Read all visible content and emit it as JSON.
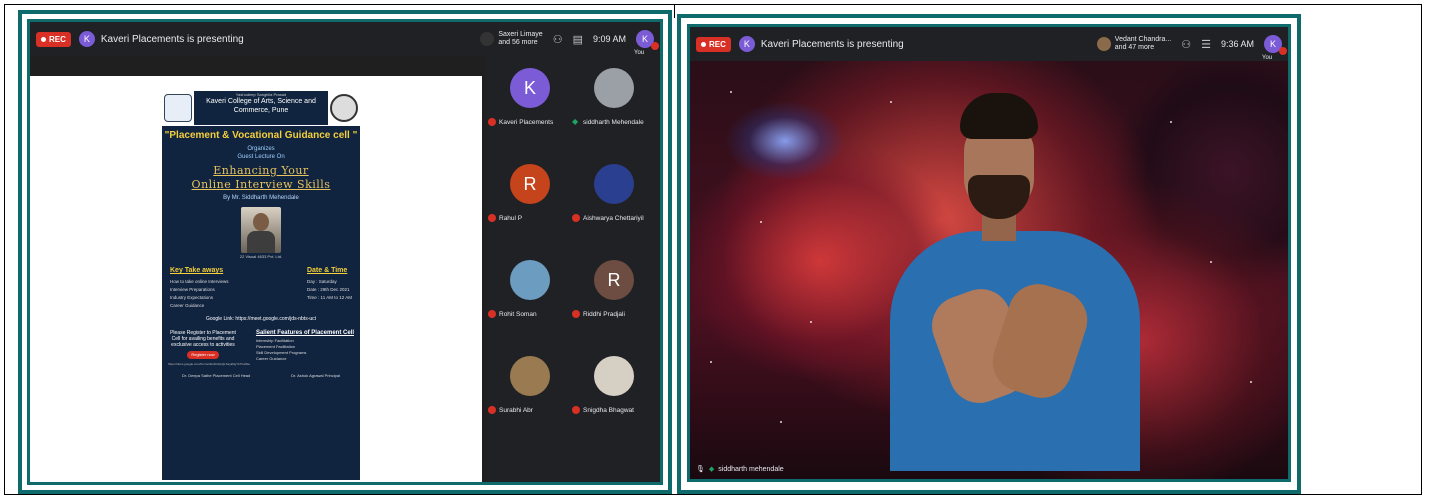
{
  "left_screen": {
    "rec_label": "REC",
    "presenter_initial": "K",
    "presenting_text": "Kaveri Placements is presenting",
    "others_text_line1": "Saxeri Limaye",
    "others_text_line2": "and 56 more",
    "clock": "9:09 AM",
    "you_initial": "K",
    "you_label": "You",
    "participants": [
      {
        "initial": "K",
        "name": "Kaveri Placements",
        "color": "#7b5cd6",
        "mic": "off"
      },
      {
        "initial": "",
        "name": "siddharth Mehendale",
        "color": "#8b8b8b",
        "mic": "on"
      },
      {
        "initial": "R",
        "name": "Rahul P",
        "color": "#c5441c",
        "mic": "off"
      },
      {
        "initial": "",
        "name": "Aishwarya Chettariyil",
        "color": "#2a3f8f",
        "mic": "off"
      },
      {
        "initial": "",
        "name": "Rohit Soman",
        "color": "#6c9cc0",
        "mic": "off"
      },
      {
        "initial": "R",
        "name": "Riddhi Pradjali",
        "color": "#6d4c41",
        "mic": "off"
      },
      {
        "initial": "",
        "name": "Surabhi Abr",
        "color": "#9a7a50",
        "mic": "off"
      },
      {
        "initial": "",
        "name": "Snigdha Bhagwat",
        "color": "#d6cfc4",
        "mic": "off"
      }
    ],
    "poster": {
      "college_tiny": "Yashodeep Sanghila Prasad",
      "college": "Kaveri College of Arts, Science and Commerce, Pune",
      "cell": "\"Placement & Vocational Guidance cell \"",
      "organizes": "Organizes",
      "guest": "Guest Lecture On",
      "title_line1": "Enhancing Your",
      "title_line2": "Online Interview Skills",
      "by": "By Mr. Siddharth Mehendale",
      "photo_caption": "22 Visual 4633 Pvt. Ltd.",
      "key_heading": "Key Take aways",
      "key_items": [
        "How to take online Interviews",
        "Interview Preparations",
        "Industry Expectations",
        "Career Guidance"
      ],
      "date_heading": "Date & Time",
      "date_items": [
        "Day : Saturday",
        "Date : 29th Dec 2021",
        "Time : 11 AM to 12 AM"
      ],
      "link": "Google Link: https://meet.google.com/jds-nbts-uct",
      "register_text": "Please Register to Placement Cell for availing benefits and exclusive access to activities",
      "register_btn": "Register now",
      "register_url": "https://docs.google.com/forms/d/e/1FAIpQLSeykDgYk7GHNa",
      "features_heading": "Salient Features of Placement Cell",
      "features": [
        "Internship Facilitation",
        "Placement Facilitation",
        "Skill Development Programs",
        "Career Guidance"
      ],
      "sign1": "Dr. Deepa Sathe Placement Cell Head",
      "sign2": "Dr. Ashok Agrawal Principal"
    }
  },
  "right_screen": {
    "rec_label": "REC",
    "presenter_initial": "K",
    "presenting_text": "Kaveri Placements is presenting",
    "others_text_line1": "Vedant Chandra...",
    "others_text_line2": "and 47 more",
    "clock": "9:36 AM",
    "you_initial": "K",
    "you_label": "You",
    "speaker_name": "siddharth mehendale"
  }
}
